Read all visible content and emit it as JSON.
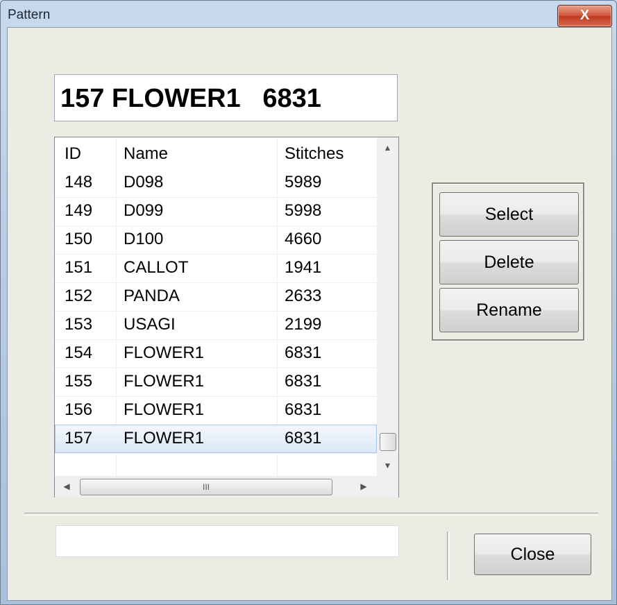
{
  "window": {
    "title": "Pattern",
    "close_glyph": "X"
  },
  "display": {
    "text": "157 FLOWER1   6831"
  },
  "list": {
    "headers": [
      "ID",
      "Name",
      "Stitches"
    ],
    "rows": [
      {
        "id": "148",
        "name": "D098",
        "stitches": "5989"
      },
      {
        "id": "149",
        "name": "D099",
        "stitches": "5998"
      },
      {
        "id": "150",
        "name": "D100",
        "stitches": "4660"
      },
      {
        "id": "151",
        "name": "CALLOT",
        "stitches": "1941"
      },
      {
        "id": "152",
        "name": "PANDA",
        "stitches": "2633"
      },
      {
        "id": "153",
        "name": "USAGI",
        "stitches": "2199"
      },
      {
        "id": "154",
        "name": "FLOWER1",
        "stitches": "6831"
      },
      {
        "id": "155",
        "name": "FLOWER1",
        "stitches": "6831"
      },
      {
        "id": "156",
        "name": "FLOWER1",
        "stitches": "6831"
      },
      {
        "id": "157",
        "name": "FLOWER1",
        "stitches": "6831"
      }
    ],
    "selected_id": "157",
    "hscroll_thumb_glyph": "III"
  },
  "buttons": {
    "select": "Select",
    "delete": "Delete",
    "rename": "Rename",
    "close": "Close"
  },
  "status": {
    "value": ""
  },
  "colors": {
    "selected_row": "#dbe8f7",
    "client_bg": "#ecece4",
    "close_button": "#d2553b"
  }
}
